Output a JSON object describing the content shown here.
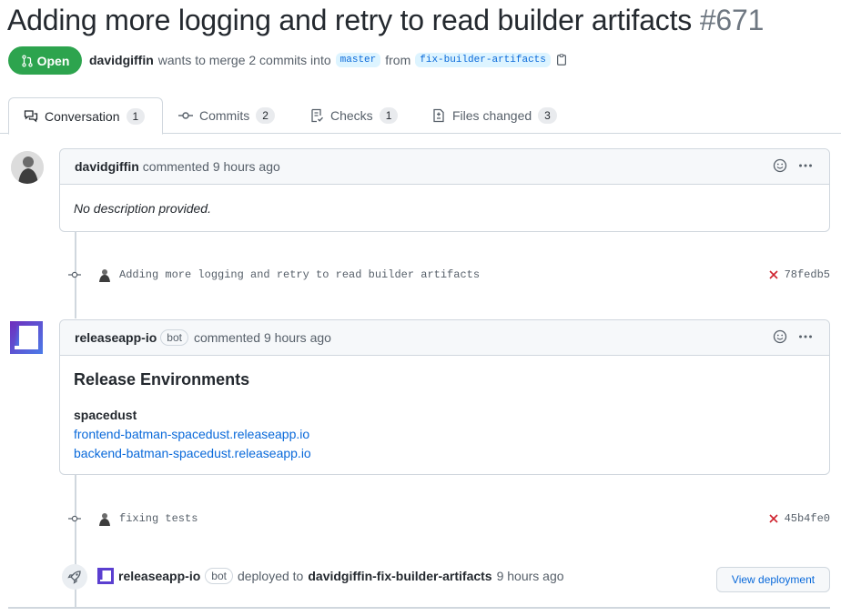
{
  "pr": {
    "title": "Adding more logging and retry to read builder artifacts",
    "number": "#671",
    "state_label": "Open",
    "author": "davidgiffin",
    "meta_text": "wants to merge 2 commits into",
    "base_branch": "master",
    "from_text": "from",
    "head_branch": "fix-builder-artifacts"
  },
  "tabs": [
    {
      "label": "Conversation",
      "count": "1",
      "icon": "comment-discussion-icon"
    },
    {
      "label": "Commits",
      "count": "2",
      "icon": "git-commit-icon"
    },
    {
      "label": "Checks",
      "count": "1",
      "icon": "checklist-icon"
    },
    {
      "label": "Files changed",
      "count": "3",
      "icon": "file-diff-icon"
    }
  ],
  "comments": [
    {
      "author": "davidgiffin",
      "action": "commented 9 hours ago",
      "body": "No description provided."
    },
    {
      "author": "releaseapp-io",
      "badge": "bot",
      "action": "commented 9 hours ago",
      "heading": "Release Environments",
      "env_name": "spacedust",
      "links": [
        "frontend-batman-spacedust.releaseapp.io",
        "backend-batman-spacedust.releaseapp.io"
      ]
    }
  ],
  "commits": [
    {
      "message": "Adding more logging and retry to read builder artifacts",
      "sha": "78fedb5",
      "status": "failed"
    },
    {
      "message": "fixing tests",
      "sha": "45b4fe0",
      "status": "failed"
    }
  ],
  "deployment": {
    "actor": "releaseapp-io",
    "badge": "bot",
    "text": "deployed to",
    "environment": "davidgiffin-fix-builder-artifacts",
    "time": "9 hours ago",
    "button_label": "View deployment"
  },
  "colors": {
    "open_green": "#2da44e",
    "link_blue": "#0969da",
    "fail_red": "#cf222e",
    "bot_purple": "#6f42c1"
  }
}
